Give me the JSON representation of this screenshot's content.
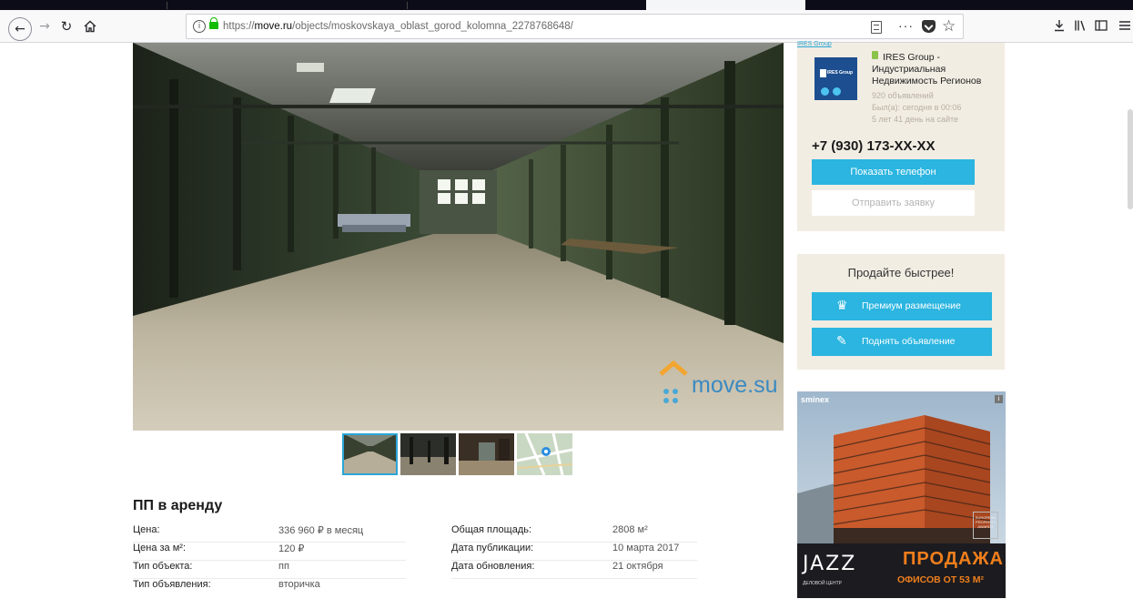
{
  "browser": {
    "url_prefix": "https://",
    "url_host": "move.ru",
    "url_path": "/objects/moskovskaya_oblast_gorod_kolomna_2278768648/"
  },
  "listing": {
    "title": "ПП в аренду",
    "watermark": "move.su",
    "params": [
      {
        "label": "Цена:",
        "value": "336 960 ₽ в месяц"
      },
      {
        "label": "Общая площадь:",
        "value": "2808 м²"
      },
      {
        "label": "Цена за м²:",
        "value": "120 ₽"
      },
      {
        "label": "Дата публикации:",
        "value": "10 марта 2017"
      },
      {
        "label": "Тип объекта:",
        "value": "пп"
      },
      {
        "label": "Дата обновления:",
        "value": "21 октября"
      },
      {
        "label": "Тип объявления:",
        "value": "вторичка"
      }
    ]
  },
  "agent": {
    "top_link": "IRES Group",
    "logo_text": "IRES Group",
    "name": "IRES Group - Индустриальная Недвижимость Регионов",
    "listings": "920 объявлений",
    "last_seen": "Был(а): сегодня в 00:06",
    "on_site": "5 лет 41 день на сайте",
    "phone": "+7 (930) 173-XX-XX",
    "show_phone": "Показать телефон",
    "send_request": "Отправить заявку"
  },
  "promo": {
    "title": "Продайте быстрее!",
    "premium": "Премиум размещение",
    "raise": "Поднять объявление"
  },
  "ad": {
    "brand": "sminex",
    "info": "i",
    "jazz": "JAZZ",
    "jazz_sub": "ДЕЛОВОЙ ЦЕНТР",
    "sale": "ПРОДАЖА",
    "sale_sub": "ОФИСОВ ОТ 53 М²",
    "award": "EUROPEAN PROPERTY AWARDS"
  }
}
